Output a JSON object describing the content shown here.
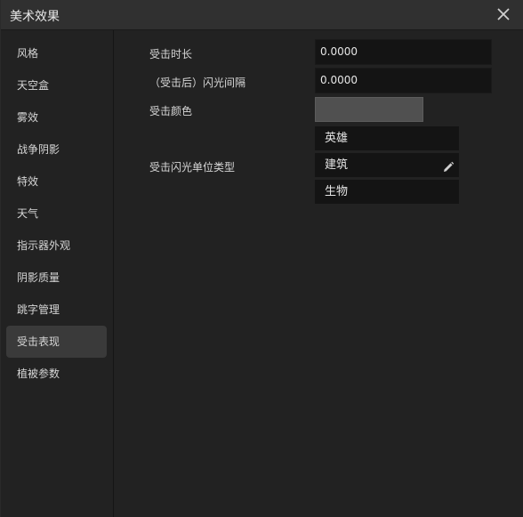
{
  "window": {
    "title": "美术效果"
  },
  "sidebar": {
    "items": [
      {
        "label": "风格"
      },
      {
        "label": "天空盒"
      },
      {
        "label": "雾效"
      },
      {
        "label": "战争阴影"
      },
      {
        "label": "特效"
      },
      {
        "label": "天气"
      },
      {
        "label": "指示器外观"
      },
      {
        "label": "阴影质量"
      },
      {
        "label": "跳字管理"
      },
      {
        "label": "受击表现"
      },
      {
        "label": "植被参数"
      }
    ],
    "active_index": 9
  },
  "form": {
    "hit_duration": {
      "label": "受击时长",
      "value": "0.0000"
    },
    "flash_interval": {
      "label": "（受击后）闪光间隔",
      "value": "0.0000"
    },
    "hit_color": {
      "label": "受击颜色",
      "color": "#505050"
    },
    "flash_unit_types": {
      "label": "受击闪光单位类型",
      "items": [
        {
          "label": "英雄"
        },
        {
          "label": "建筑"
        },
        {
          "label": "生物"
        }
      ]
    }
  },
  "icons": {
    "close": "close-icon",
    "edit": "pencil-icon"
  },
  "colors": {
    "titlebar_bg": "#303030",
    "panel_bg": "#222222",
    "field_bg": "#141414",
    "active_nav_bg": "#3a3a3a"
  }
}
